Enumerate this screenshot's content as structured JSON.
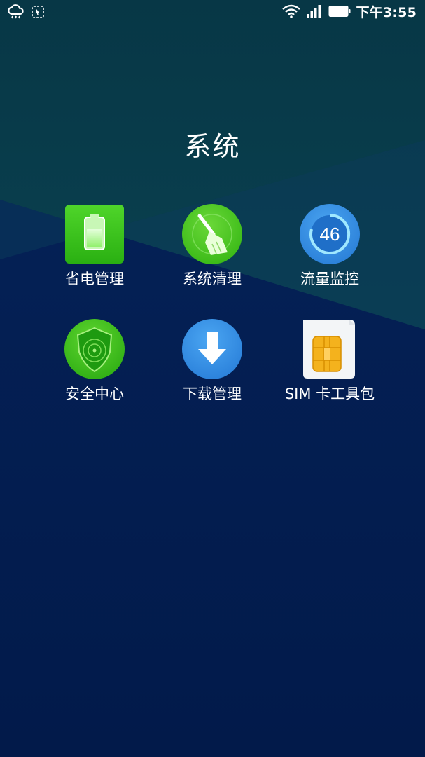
{
  "status_bar": {
    "time": "下午3:55",
    "left_icons": [
      "weather-cloud-icon",
      "screenshot-icon"
    ],
    "right_icons": [
      "wifi-icon",
      "signal-icon",
      "battery-icon"
    ]
  },
  "folder": {
    "title": "系统"
  },
  "apps": [
    {
      "label": "省电管理",
      "icon": "battery-saver-icon"
    },
    {
      "label": "系统清理",
      "icon": "broom-icon"
    },
    {
      "label": "流量监控",
      "icon": "data-usage-icon",
      "badge": "46"
    },
    {
      "label": "安全中心",
      "icon": "shield-icon"
    },
    {
      "label": "下载管理",
      "icon": "download-arrow-icon"
    },
    {
      "label": "SIM 卡工具包",
      "icon": "sim-card-icon"
    }
  ],
  "colors": {
    "bg_top": "#063a4a",
    "bg_bottom": "#031b4d",
    "green": "#3cc21a",
    "blue": "#2f8de4"
  }
}
